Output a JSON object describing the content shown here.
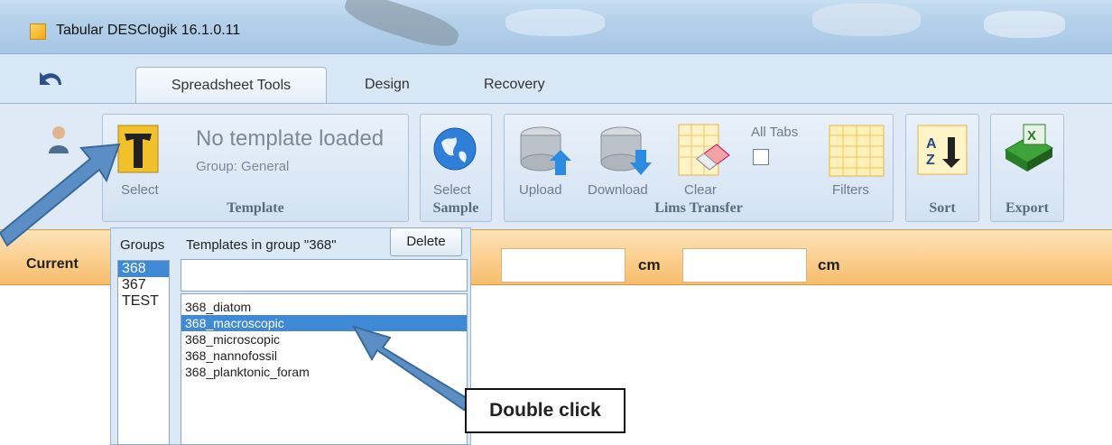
{
  "window": {
    "title": "Tabular DESClogik 16.1.0.11"
  },
  "tabs": [
    {
      "label": "Spreadsheet Tools",
      "active": true
    },
    {
      "label": "Design"
    },
    {
      "label": "Recovery"
    }
  ],
  "ribbon": {
    "template_group": {
      "select_label": "Select",
      "status": "No template loaded",
      "subtext": "Group: General",
      "label": "Template"
    },
    "sample_group": {
      "select_label": "Select",
      "label": "Sample"
    },
    "lims_group": {
      "upload_label": "Upload",
      "download_label": "Download",
      "clear_label": "Clear",
      "all_tabs_label": "All Tabs",
      "all_tabs_checked": false,
      "filters_label": "Filters",
      "label": "Lims Transfer"
    },
    "sort_group": {
      "label": "Sort"
    },
    "export_group": {
      "label": "Export"
    }
  },
  "current_bar": {
    "label": "Current",
    "unit1": "cm",
    "unit2": "cm"
  },
  "template_panel": {
    "groups_label": "Groups",
    "templates_label": "Templates in group \"368\"",
    "delete_label": "Delete",
    "groups": [
      {
        "label": "368",
        "selected": true
      },
      {
        "label": "367"
      },
      {
        "label": "TEST"
      }
    ],
    "templates": [
      {
        "label": "368_diatom"
      },
      {
        "label": "368_macroscopic",
        "selected": true
      },
      {
        "label": "368_microscopic"
      },
      {
        "label": "368_nannofossil"
      },
      {
        "label": "368_planktonic_foram"
      }
    ]
  },
  "callout": {
    "text": "Double click"
  },
  "colors": {
    "accent_blue": "#5b8ec4",
    "selection": "#3f8ad6",
    "orange_bar": "#fbd092"
  }
}
